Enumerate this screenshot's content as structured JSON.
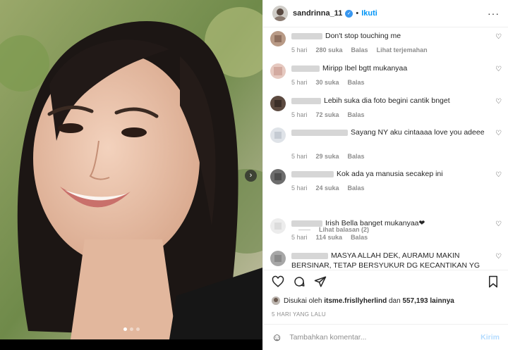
{
  "post": {
    "username": "sandrinna_11",
    "follow_label": "Ikuti",
    "separator": "•",
    "more_icon": "more-horizontal-icon"
  },
  "photo": {
    "next_icon": "chevron-right-icon",
    "slides": 3,
    "active_slide": 0
  },
  "comments": [
    {
      "text": "Don't stop touching me",
      "age": "5 hari",
      "likes": "280 suka",
      "reply": "Balas",
      "translate": "Lihat terjemahan"
    },
    {
      "text": "Miripp Ibel bgtt mukanyaa",
      "age": "5 hari",
      "likes": "30 suka",
      "reply": "Balas"
    },
    {
      "text": "Lebih suka dia foto begini  cantik bnget",
      "age": "5 hari",
      "likes": "72 suka",
      "reply": "Balas"
    },
    {
      "text": "Sayang NY aku cintaaaa love you adeee",
      "age": "5 hari",
      "likes": "29 suka",
      "reply": "Balas"
    },
    {
      "text": "Kok ada ya manusia secakep ini",
      "age": "5 hari",
      "likes": "24 suka",
      "reply": "Balas"
    },
    {
      "text": "Irish Bella banget mukanyaa❤",
      "age": "5 hari",
      "likes": "114 suka",
      "reply": "Balas"
    },
    {
      "text": "MASYA ALLAH DEK, AURAMU MAKIN BERSINAR, TETAP BERSYUKUR DG KECANTIKAN YG KAMU PUNYA, TETAP"
    }
  ],
  "view_replies": "Lihat balasan (2)",
  "likes_line": {
    "prefix": "Disukai oleh",
    "liker": "itsme.frisllyherlind",
    "middle": "dan",
    "count": "557,193 lainnya"
  },
  "timestamp": "5 HARI YANG LALU",
  "add_comment": {
    "placeholder": "Tambahkan komentar...",
    "post_label": "Kirim"
  },
  "colors": {
    "accent": "#0095f6",
    "verified": "#3897f0",
    "muted": "#8e8e8e"
  }
}
